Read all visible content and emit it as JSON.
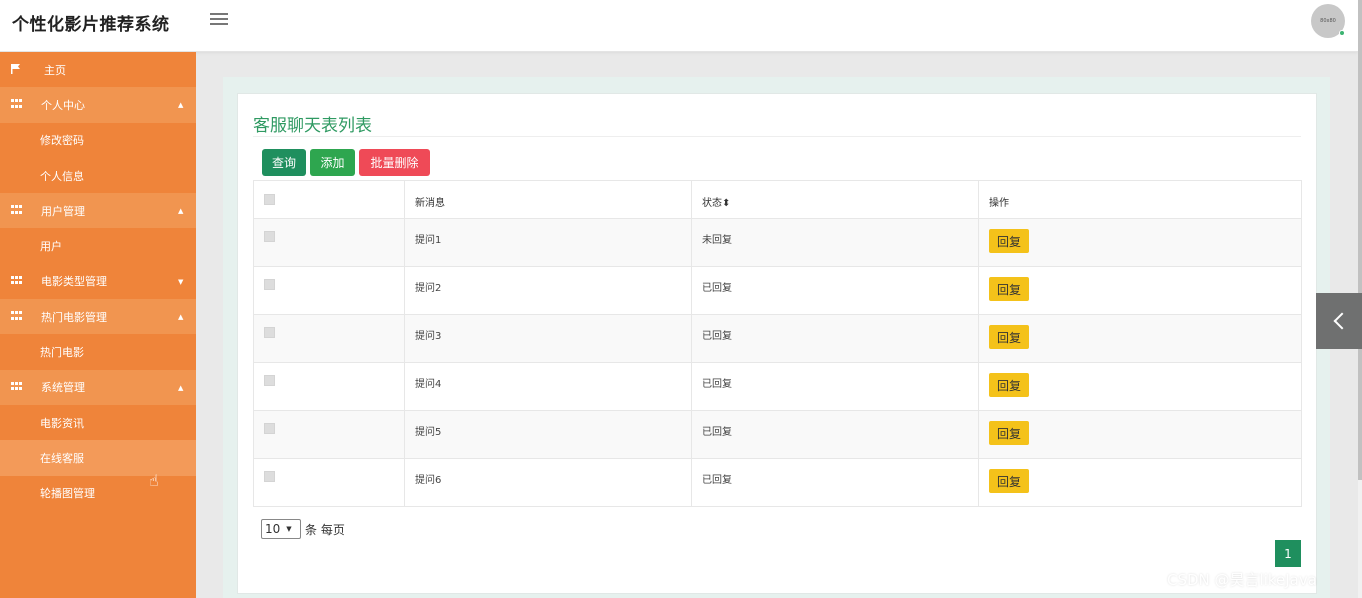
{
  "header": {
    "app_title": "个性化影片推荐系统",
    "avatar_text": "80x80"
  },
  "sidebar": {
    "items": [
      {
        "label": "主页",
        "icon": "flag-icon"
      },
      {
        "label": "个人中心",
        "icon": "grid-icon",
        "caret": "▲"
      },
      {
        "label": "修改密码"
      },
      {
        "label": "个人信息"
      },
      {
        "label": "用户管理",
        "icon": "grid-icon",
        "caret": "▲"
      },
      {
        "label": "用户"
      },
      {
        "label": "电影类型管理",
        "icon": "grid-icon",
        "caret": "▼"
      },
      {
        "label": "热门电影管理",
        "icon": "grid-icon",
        "caret": "▲"
      },
      {
        "label": "热门电影"
      },
      {
        "label": "系统管理",
        "icon": "grid-icon",
        "caret": "▲"
      },
      {
        "label": "电影资讯"
      },
      {
        "label": "在线客服"
      },
      {
        "label": "轮播图管理"
      }
    ]
  },
  "main": {
    "title": "客服聊天表列表",
    "buttons": {
      "query": "查询",
      "add": "添加",
      "batch_delete": "批量删除"
    },
    "table": {
      "headers": {
        "message": "新消息",
        "status": "状态",
        "sort_glyph": "⬍",
        "operation": "操作"
      },
      "rows": [
        {
          "message": "提问1",
          "status": "未回复",
          "action": "回复"
        },
        {
          "message": "提问2",
          "status": "已回复",
          "action": "回复"
        },
        {
          "message": "提问3",
          "status": "已回复",
          "action": "回复"
        },
        {
          "message": "提问4",
          "status": "已回复",
          "action": "回复"
        },
        {
          "message": "提问5",
          "status": "已回复",
          "action": "回复"
        },
        {
          "message": "提问6",
          "status": "已回复",
          "action": "回复"
        }
      ]
    },
    "pagination": {
      "page_size": "10",
      "page_size_suffix": "条 每页",
      "current_page": "1"
    }
  },
  "watermark": "CSDN @昊言likeJava",
  "colors": {
    "sidebar": "#ef843a",
    "accent_green": "#1f8f5e",
    "add_green": "#2ea64f",
    "delete_red": "#ef4a57",
    "reply_yellow": "#f4c21a"
  }
}
